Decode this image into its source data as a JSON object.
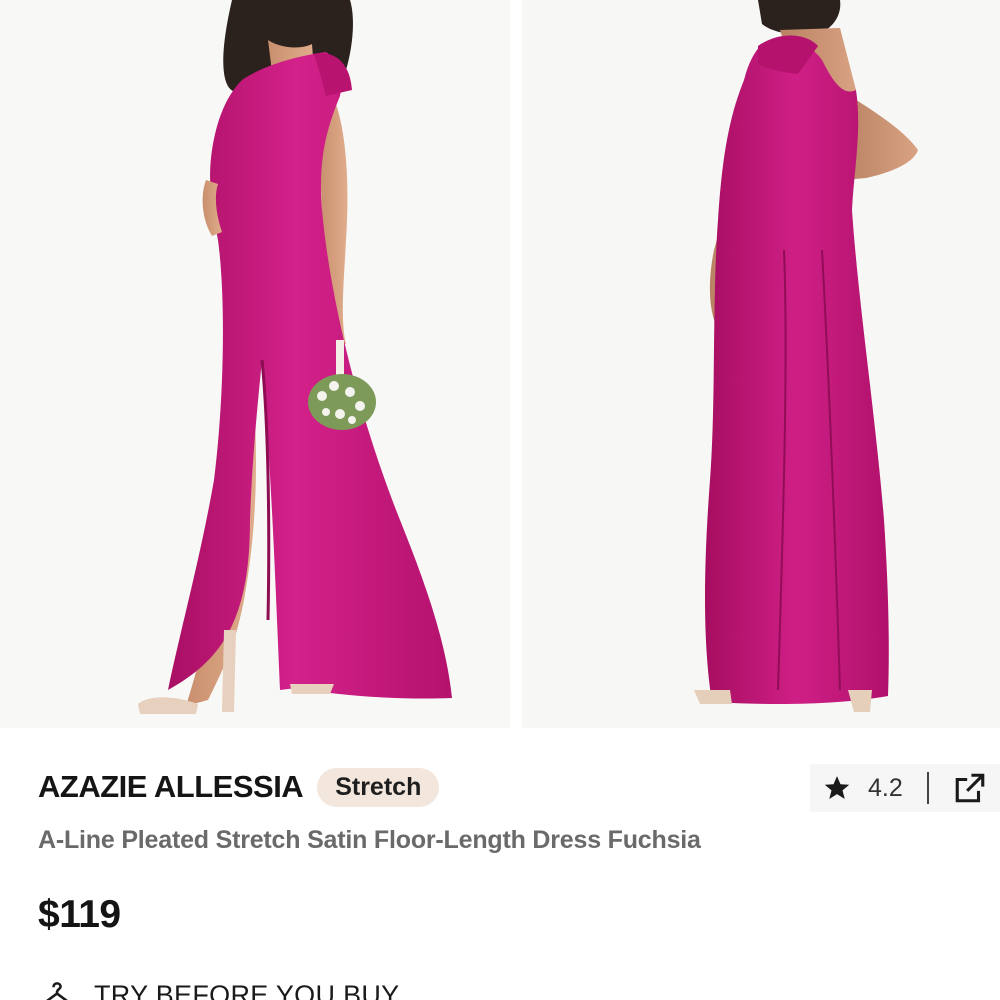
{
  "gallery": {
    "images": [
      {
        "icon": "model-front-photo"
      },
      {
        "icon": "model-back-photo"
      }
    ]
  },
  "product": {
    "brand": "AZAZIE ALLESSIA",
    "badge": "Stretch",
    "title": "A-Line Pleated Stretch Satin Floor-Length Dress Fuchsia",
    "price": "$119",
    "rating": "4.2"
  },
  "actions": {
    "try_before_you_buy": "TRY BEFORE YOU BUY"
  },
  "colors": {
    "dress": "#c4177a",
    "badge_bg": "#f3e6dc",
    "rating_bg": "#f6f6f6"
  }
}
